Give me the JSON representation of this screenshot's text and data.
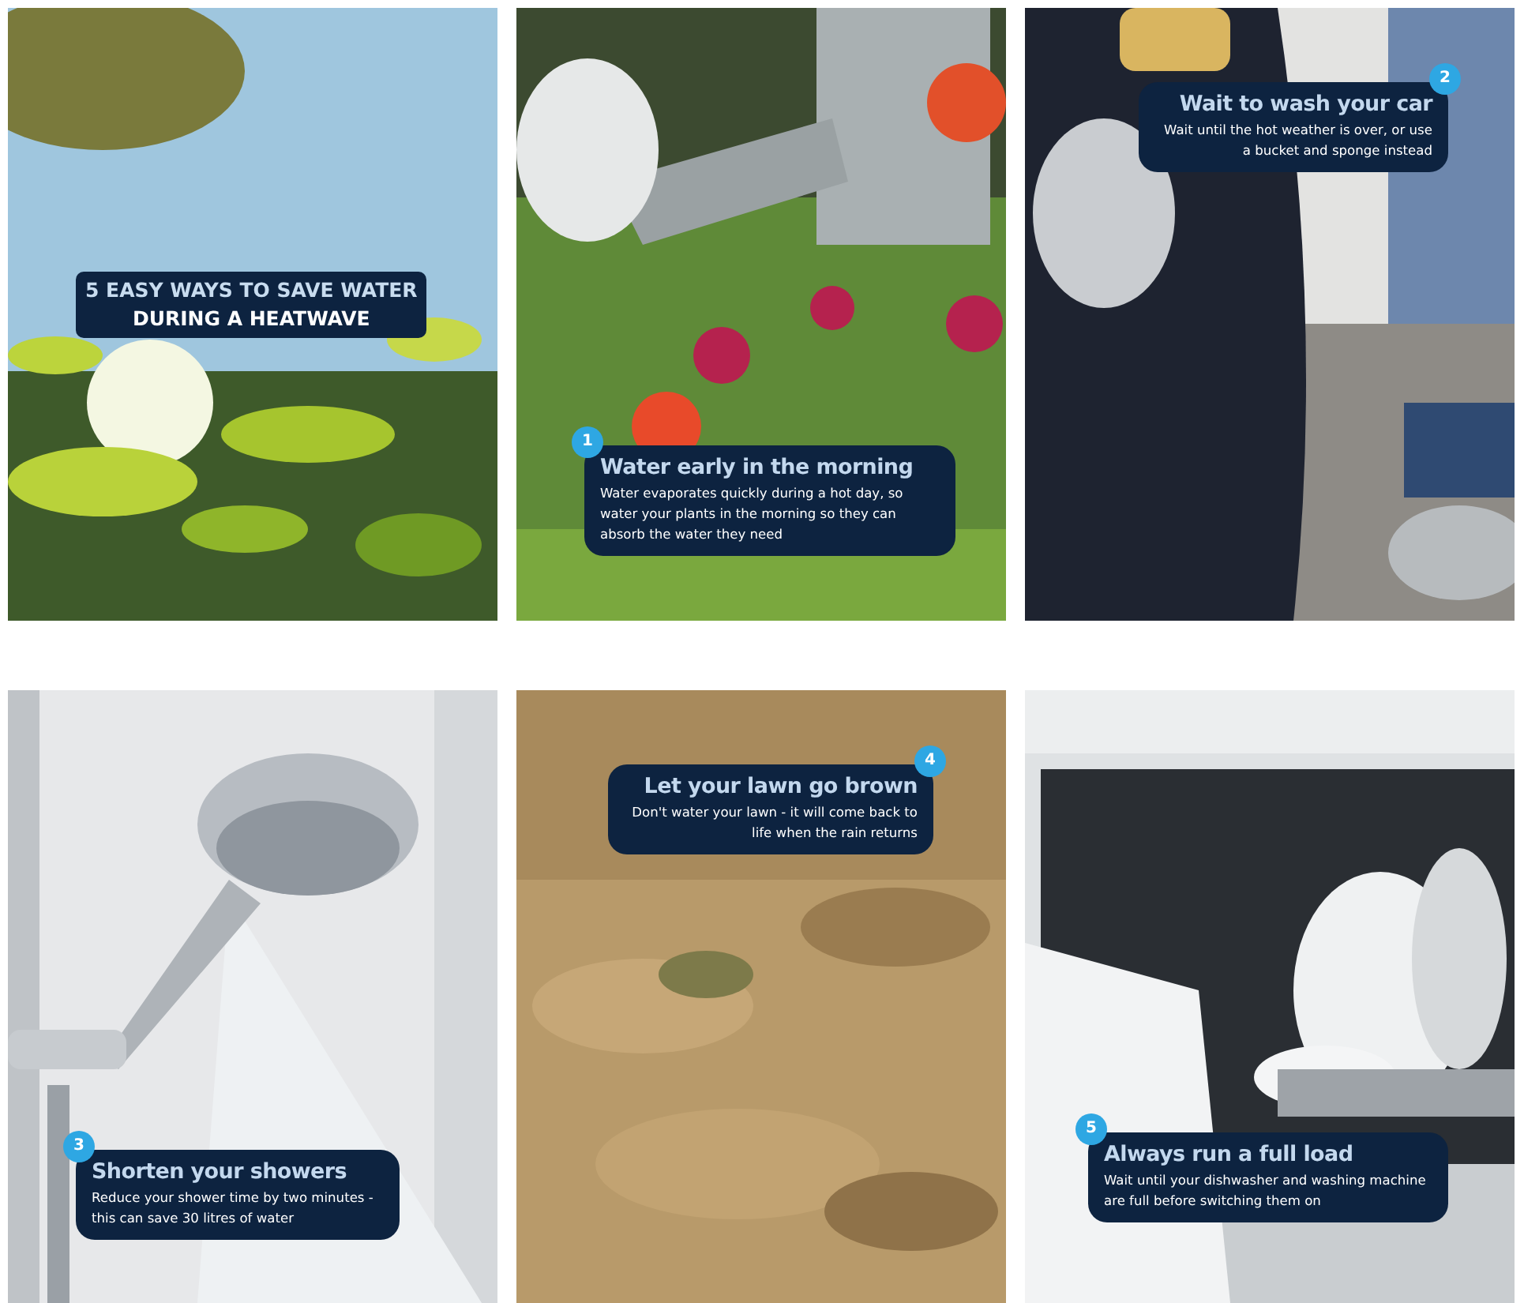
{
  "tiles": [
    {
      "kind": "title",
      "lines": [
        "5 EASY WAYS TO SAVE WATER",
        "DURING A HEATWAVE"
      ]
    },
    {
      "kind": "tip",
      "number": "1",
      "heading": "Water early in the morning",
      "text": "Water evaporates quickly during a hot day, so water your plants in the morning so they can absorb the water they need"
    },
    {
      "kind": "tip",
      "number": "2",
      "heading": "Wait to wash your car",
      "text": "Wait until the hot weather is over, or use a bucket and sponge instead"
    },
    {
      "kind": "tip",
      "number": "3",
      "heading": "Shorten your showers",
      "text": "Reduce your shower time by two minutes - this can save 30 litres of water"
    },
    {
      "kind": "tip",
      "number": "4",
      "heading": "Let your lawn go brown",
      "text": "Don't water your lawn - it will come back to life when the rain returns"
    },
    {
      "kind": "tip",
      "number": "5",
      "heading": "Always run a full load",
      "text": "Wait until your dishwasher and washing machine are full before switching them on"
    }
  ]
}
